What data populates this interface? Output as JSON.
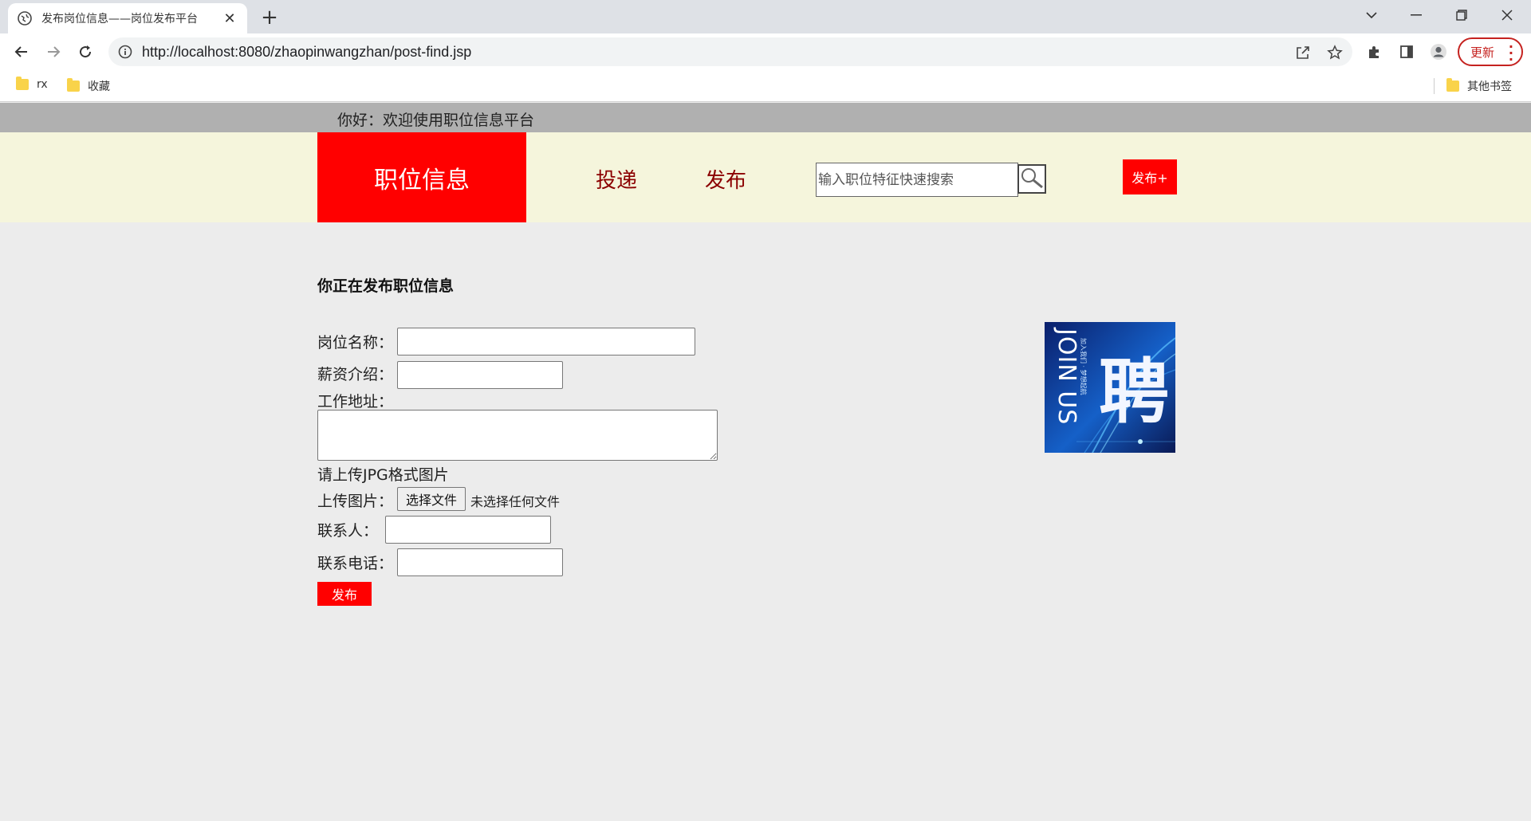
{
  "browser": {
    "tab_title": "发布岗位信息——岗位发布平台",
    "url": "http://localhost:8080/zhaopinwangzhan/post-find.jsp",
    "update_label": "更新",
    "bookmarks": [
      "rx",
      "收藏"
    ],
    "other_bookmarks": "其他书签"
  },
  "site": {
    "greeting": "你好：欢迎使用职位信息平台",
    "brand": "职位信息",
    "nav": [
      "投递",
      "发布"
    ],
    "search_placeholder": "输入职位特征快速搜索",
    "post_button": "发布+"
  },
  "form": {
    "title": "你正在发布职位信息",
    "job_name_label": "岗位名称：",
    "salary_label": "薪资介绍：",
    "address_label": "工作地址：",
    "upload_hint": "请上传JPG格式图片",
    "upload_label": "上传图片：",
    "choose_file": "选择文件",
    "no_file": "未选择任何文件",
    "contact_label": "联系人：",
    "phone_label": "联系电话：",
    "submit": "发布"
  },
  "poster": {
    "vertical_text": "JOIN US",
    "glyph": "聘",
    "subtitle": "加入我们 · 梦想起航"
  },
  "colors": {
    "brand_red": "#ff0000",
    "header_bg": "#f5f5dc",
    "greet_bar": "#b0b0b0",
    "nav_text": "#8b0000",
    "page_bg": "#ececec"
  }
}
